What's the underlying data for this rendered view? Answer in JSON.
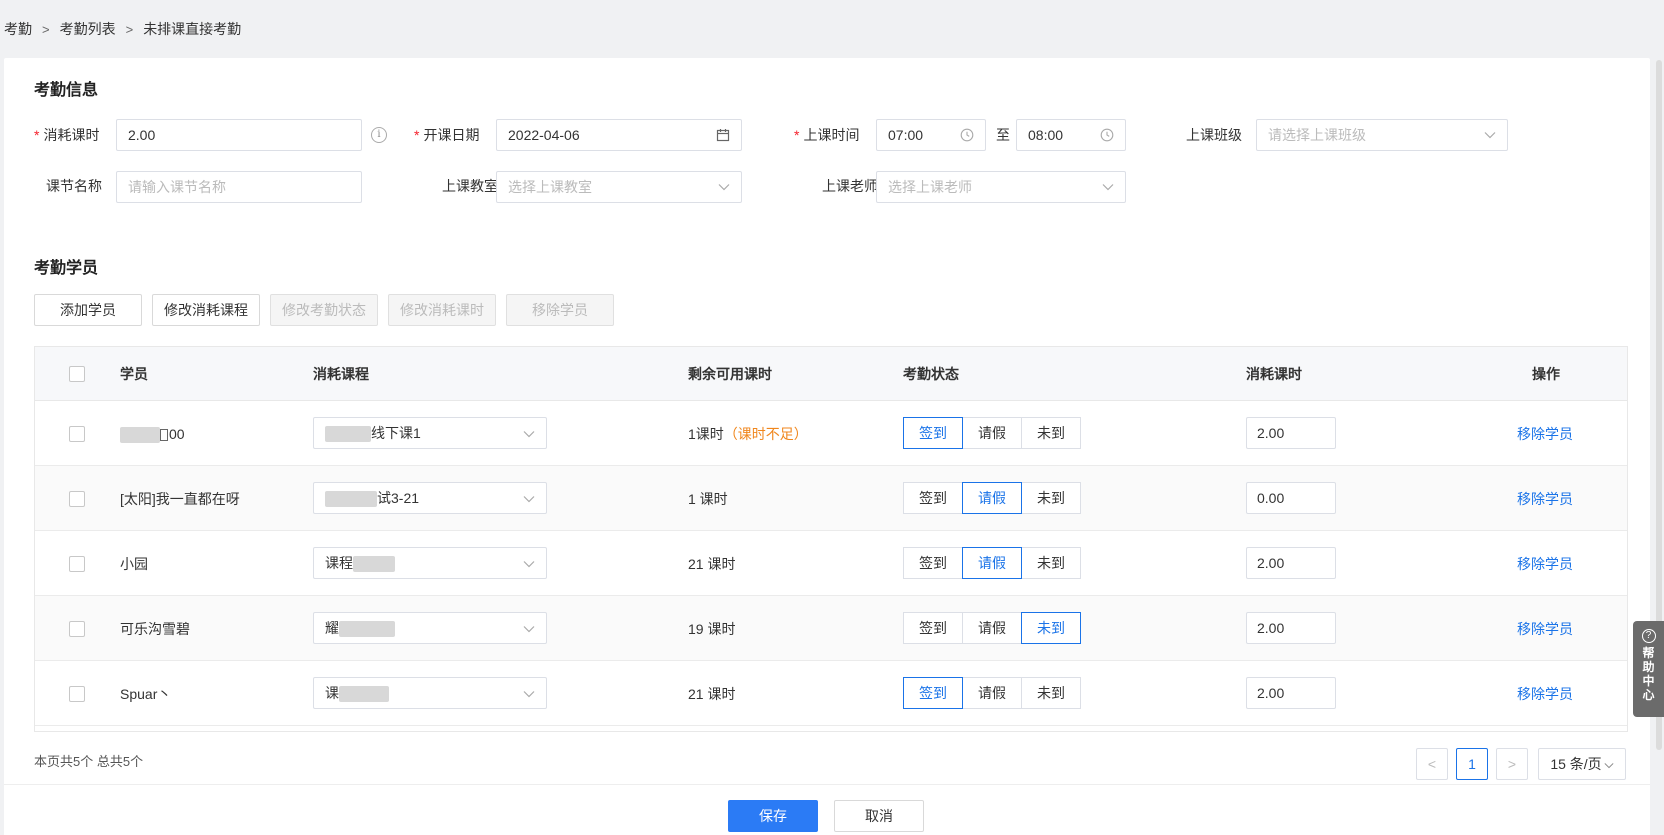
{
  "breadcrumb": [
    "考勤",
    "考勤列表",
    "未排课直接考勤"
  ],
  "breadcrumb_sep": ">",
  "info": {
    "title": "考勤信息",
    "required_mark": "*",
    "hours_label": "消耗课时",
    "hours_value": "2.00",
    "date_label": "开课日期",
    "date_value": "2022-04-06",
    "time_label": "上课时间",
    "time_start": "07:00",
    "time_to": "至",
    "time_end": "08:00",
    "class_label": "上课班级",
    "class_placeholder": "请选择上课班级",
    "lesson_label": "课节名称",
    "lesson_placeholder": "请输入课节名称",
    "room_label": "上课教室",
    "room_placeholder": "选择上课教室",
    "teacher_label": "上课老师",
    "teacher_placeholder": "选择上课老师"
  },
  "students": {
    "title": "考勤学员",
    "buttons": {
      "add": "添加学员",
      "change_course": "修改消耗课程",
      "change_status": "修改考勤状态",
      "change_hours": "修改消耗课时",
      "remove": "移除学员"
    },
    "columns": [
      "学员",
      "消耗课程",
      "剩余可用课时",
      "考勤状态",
      "消耗课时",
      "操作"
    ],
    "status_options": [
      "签到",
      "请假",
      "未到"
    ],
    "action_label": "移除学员",
    "rows": [
      {
        "name": "00",
        "course": "线下课1",
        "remaining": "1课时",
        "warning": "（课时不足）",
        "status": "签到",
        "hours": "2.00"
      },
      {
        "name": "[太阳]我一直都在呀",
        "course": "试3-21",
        "remaining": "1 课时",
        "warning": "",
        "status": "请假",
        "hours": "0.00"
      },
      {
        "name": "小园",
        "course": "课程",
        "remaining": "21 课时",
        "warning": "",
        "status": "请假",
        "hours": "2.00"
      },
      {
        "name": "可乐沟雪碧",
        "course": "耀",
        "remaining": "19 课时",
        "warning": "",
        "status": "未到",
        "hours": "2.00"
      },
      {
        "name": "Spuar丶",
        "course": "课",
        "remaining": "21 课时",
        "warning": "",
        "status": "签到",
        "hours": "2.00"
      }
    ]
  },
  "pagination": {
    "summary": "本页共5个 总共5个",
    "current_page": "1",
    "page_size": "15 条/页",
    "prev": "<",
    "next": ">"
  },
  "footer": {
    "save": "保存",
    "cancel": "取消"
  },
  "help": {
    "label": "帮助中心",
    "icon_text": "?"
  },
  "colors": {
    "primary": "#2b7bf5",
    "link": "#1a73e8",
    "warning": "#f0861c",
    "required": "#f5222d"
  }
}
